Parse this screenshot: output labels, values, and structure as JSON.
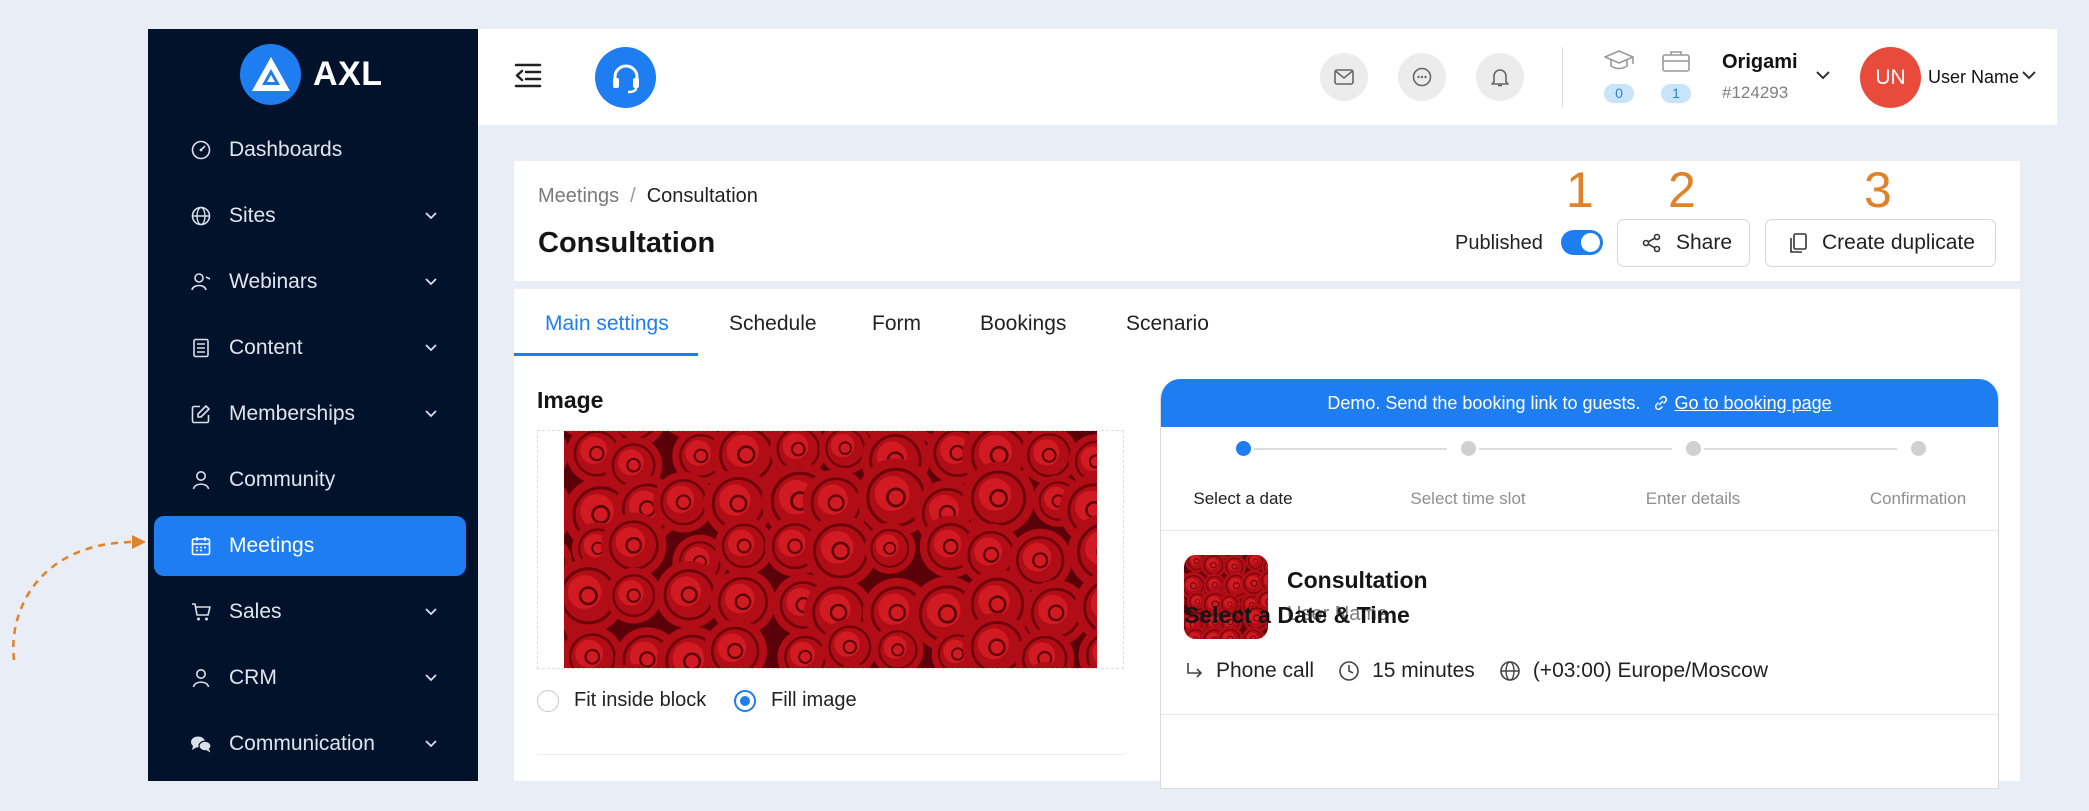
{
  "brand": {
    "name": "AXL",
    "accent": "#1e7df0",
    "sidebar_bg": "#03122b"
  },
  "sidebar": {
    "items": [
      {
        "label": "Dashboards",
        "icon": "dashboard-icon",
        "expandable": false,
        "active": false
      },
      {
        "label": "Sites",
        "icon": "globe-icon",
        "expandable": true,
        "active": false
      },
      {
        "label": "Webinars",
        "icon": "webinar-icon",
        "expandable": true,
        "active": false
      },
      {
        "label": "Content",
        "icon": "book-icon",
        "expandable": true,
        "active": false
      },
      {
        "label": "Memberships",
        "icon": "edit-icon",
        "expandable": true,
        "active": false
      },
      {
        "label": "Community",
        "icon": "user-icon",
        "expandable": false,
        "active": false
      },
      {
        "label": "Meetings",
        "icon": "calendar-icon",
        "expandable": false,
        "active": true
      },
      {
        "label": "Sales",
        "icon": "cart-icon",
        "expandable": true,
        "active": false
      },
      {
        "label": "CRM",
        "icon": "user-icon",
        "expandable": true,
        "active": false
      },
      {
        "label": "Communication",
        "icon": "chat-icon",
        "expandable": true,
        "active": false
      }
    ]
  },
  "topbar": {
    "courses_count": "0",
    "products_count": "1",
    "org_name": "Origami",
    "org_id": "#124293",
    "avatar_initials": "UN",
    "user_name": "User Name"
  },
  "header": {
    "breadcrumb": [
      "Meetings",
      "Consultation"
    ],
    "title": "Consultation",
    "published_label": "Published",
    "published": true,
    "share_label": "Share",
    "duplicate_label": "Create duplicate",
    "markers": [
      "1",
      "2",
      "3"
    ]
  },
  "tabs": [
    "Main settings",
    "Schedule",
    "Form",
    "Bookings",
    "Scenario"
  ],
  "image_section": {
    "title": "Image",
    "options": [
      "Fit inside block",
      "Fill image"
    ],
    "selected": "Fill image"
  },
  "preview": {
    "demo_text": "Demo. Send the booking link to guests.",
    "demo_link": "Go to booking page",
    "steps": [
      "Select a date",
      "Select time slot",
      "Enter details",
      "Confirmation"
    ],
    "active_step": 0,
    "meeting_title": "Consultation",
    "meeting_user": "User Name",
    "location": "Phone call",
    "duration": "15 minutes",
    "timezone": "(+03:00) Europe/Moscow",
    "date_time_title": "Select a Date & Time"
  }
}
